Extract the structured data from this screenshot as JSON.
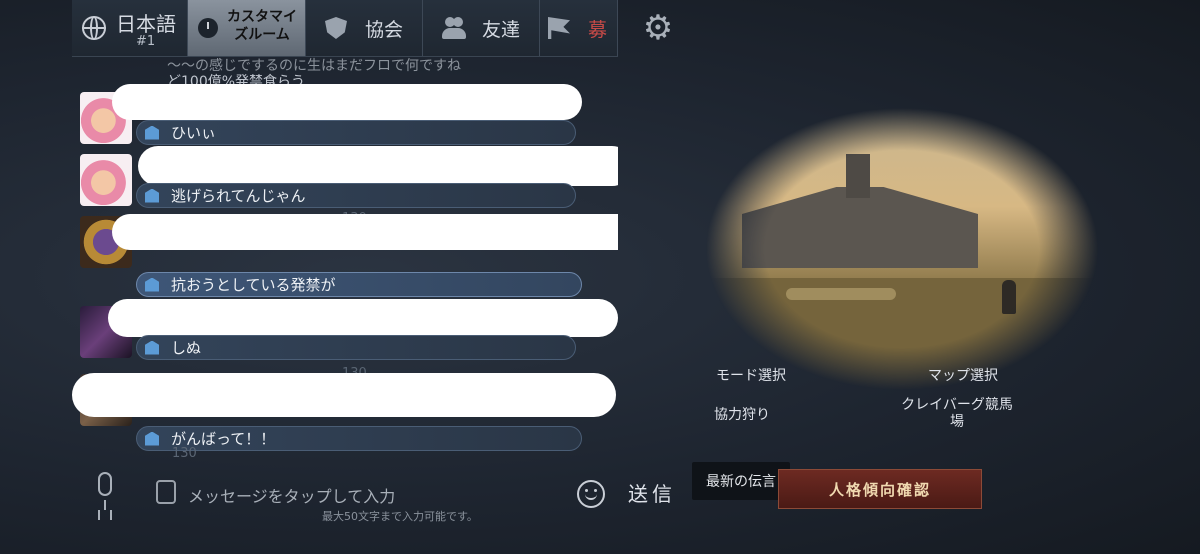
{
  "tabs": {
    "language": {
      "label": "日本語",
      "sub": "#1"
    },
    "custom_room": {
      "label": "カスタマイズルーム"
    },
    "guild": {
      "label": "協会"
    },
    "friends": {
      "label": "友達"
    },
    "recruit": {
      "label": "募"
    }
  },
  "icons": [
    "globe-icon",
    "clock-icon",
    "shield-icon",
    "friends-icon",
    "flag-icon",
    "gear-icon",
    "mic-icon",
    "keyboard-icon",
    "smiley-icon",
    "guild-badge-icon"
  ],
  "chat": {
    "cut_off_top": [
      "～～の感じでするのに生はまだフロで何ですね",
      "ど100億%発禁食らう"
    ],
    "messages": [
      {
        "text": "ひいぃ"
      },
      {
        "text": "逃げられてんじゃん"
      },
      {
        "text": "抗おうとしている発禁が"
      },
      {
        "text": "しぬ"
      },
      {
        "text": "がんばって！！"
      }
    ],
    "faint_numbers": [
      "130",
      "130",
      "130"
    ]
  },
  "input": {
    "placeholder": "メッセージをタップして入力",
    "limit": "最大50文字まで入力可能です。"
  },
  "send_label": "送信",
  "room": {
    "mode_label": "モード選択",
    "map_label": "マップ選択",
    "mode_value": "協力狩り",
    "map_value": "クレイバーグ競馬場"
  },
  "notice_label": "最新の伝言",
  "personality_button": "人格傾向確認",
  "colors": {
    "accent_blue": "#5c9bd6",
    "button_red": "#6d2a22",
    "recruit_red": "#c74a47"
  }
}
